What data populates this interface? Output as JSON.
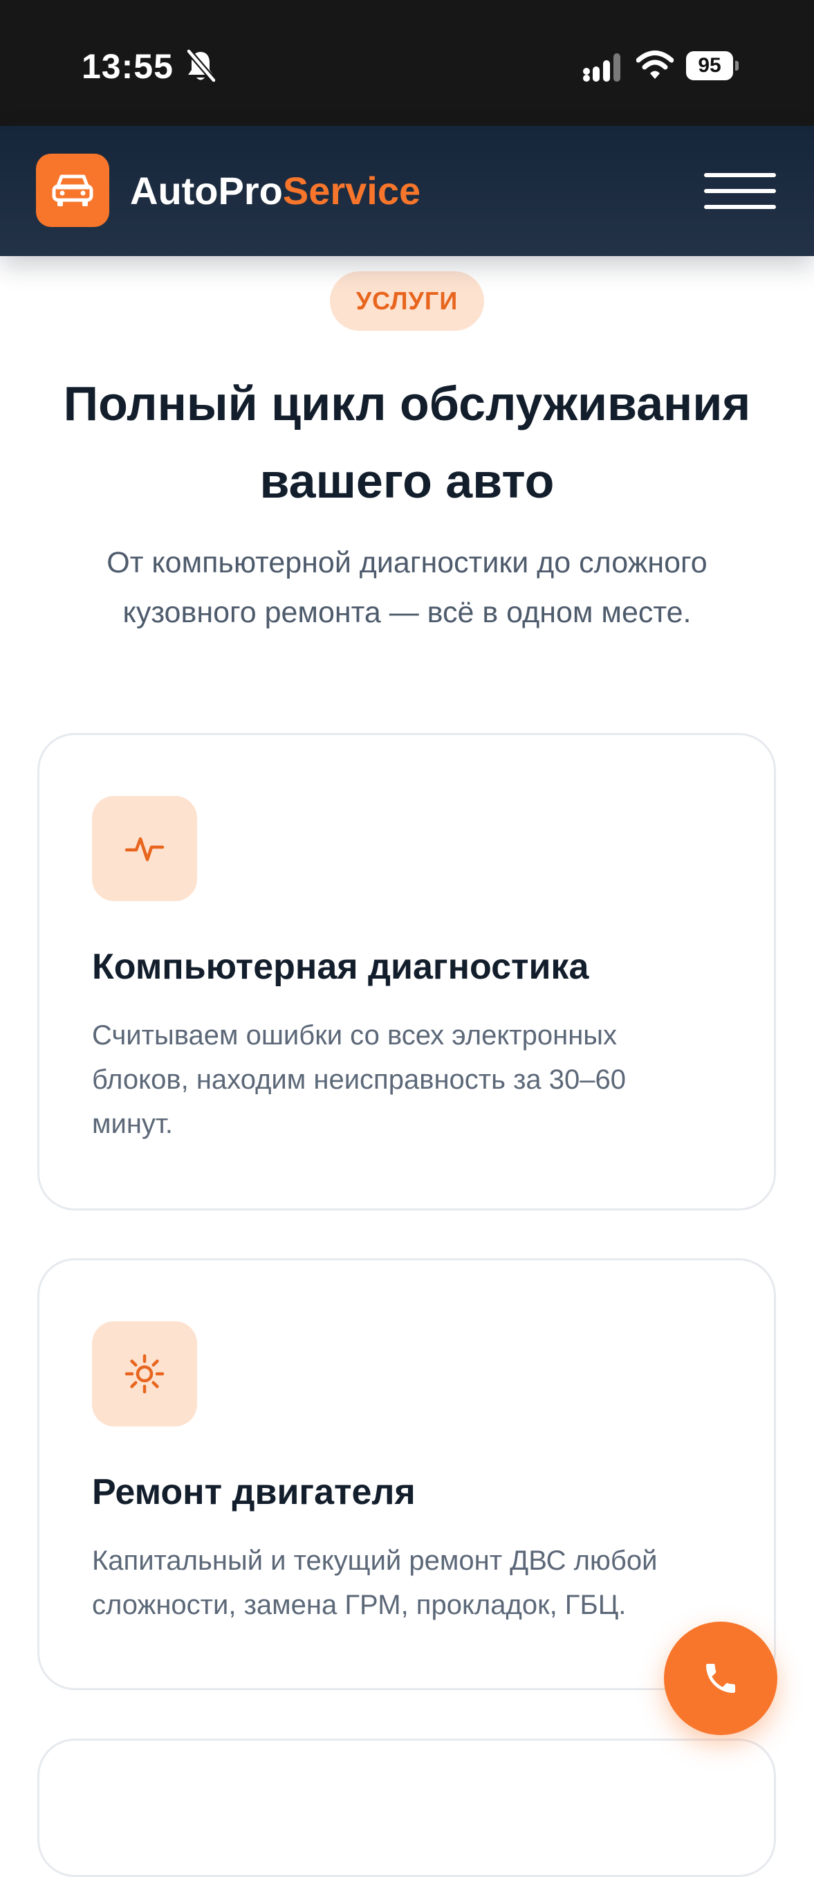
{
  "status_bar": {
    "time": "13:55",
    "battery": "95",
    "icons": [
      "bell-off-icon",
      "signal-icon",
      "wifi-icon",
      "battery-icon"
    ]
  },
  "header": {
    "brand_part1": "AutoPro",
    "brand_part2": "Service",
    "logo_icon": "car-icon",
    "menu_icon": "hamburger-menu-icon"
  },
  "intro": {
    "badge": "УСЛУГИ",
    "title": "Полный цикл обслуживания вашего авто",
    "subtitle": "От компьютерной диагностики до сложного кузовного ремонта — всё в одном месте."
  },
  "services": [
    {
      "icon": "pulse-icon",
      "title": "Компьютерная диагностика",
      "text": "Считываем ошибки со всех электронных блоков, находим неисправность за 30–60 минут."
    },
    {
      "icon": "sun-gear-icon",
      "title": "Ремонт двигателя",
      "text": "Капитальный и текущий ремонт ДВС любой сложности, замена ГРМ, прокладок, ГБЦ."
    }
  ],
  "call_button": {
    "icon": "phone-icon"
  },
  "colors": {
    "accent": "#f7762b",
    "header_bg": "#1c2b3e",
    "badge_bg": "#fde2d0",
    "text_dark": "#131e2c",
    "text_muted": "#5c6878"
  }
}
